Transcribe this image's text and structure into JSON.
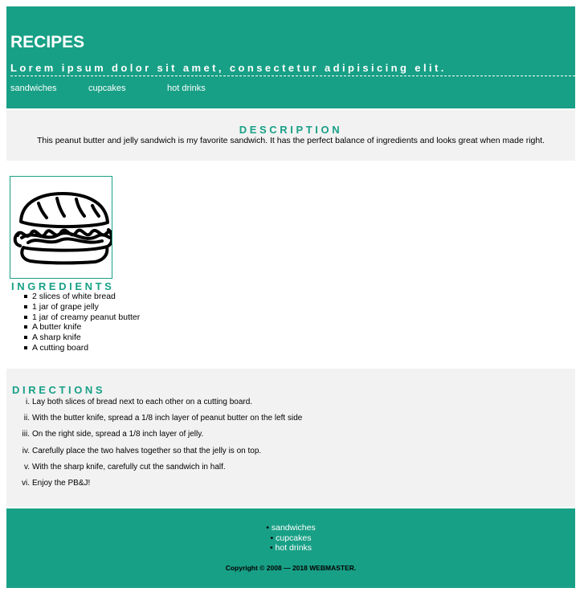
{
  "header": {
    "title": "RECIPES",
    "tagline": "Lorem ipsum dolor sit amet, consectetur adipisicing elit.",
    "nav": [
      "sandwiches",
      "cupcakes",
      "hot drinks"
    ]
  },
  "description": {
    "heading": "DESCRIPTION",
    "text": "This peanut butter and jelly sandwich is my favorite sandwich. It has the perfect balance of ingredients and looks great when made right."
  },
  "ingredients": {
    "heading": "INGREDIENTS",
    "image_icon": "sandwich-icon",
    "items": [
      "2 slices of white bread",
      "1 jar of grape jelly",
      "1 jar of creamy peanut butter",
      "A butter knife",
      "A sharp knife",
      "A cutting board"
    ]
  },
  "directions": {
    "heading": "DIRECTIONS",
    "steps": [
      {
        "num": "i.",
        "text": "Lay both slices of bread next to each other on a cutting board."
      },
      {
        "num": "ii.",
        "text": "With the butter knife, spread a 1/8 inch layer of peanut butter on the left side"
      },
      {
        "num": "iii.",
        "text": "On the right side, spread a 1/8 inch layer of jelly."
      },
      {
        "num": "iv.",
        "text": "Carefully place the two halves together so that the jelly is on top."
      },
      {
        "num": "v.",
        "text": "With the sharp knife, carefully cut the sandwich in half."
      },
      {
        "num": "vi.",
        "text": "Enjoy the PB&J!"
      }
    ]
  },
  "footer": {
    "nav": [
      "sandwiches",
      "cupcakes",
      "hot drinks"
    ],
    "copyright": "Copyright © 2008 — 2018 WEBMASTER."
  },
  "colors": {
    "accent": "#18a086",
    "section_bg": "#f2f2f2"
  }
}
